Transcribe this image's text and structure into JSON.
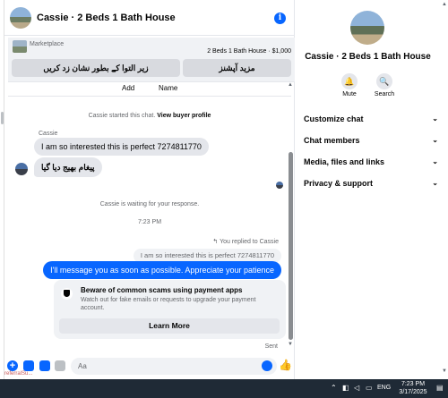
{
  "chat": {
    "title": "Cassie · 2 Beds 1 Bath House",
    "marketplace_label": "Marketplace",
    "listing": "2 Beds 1 Bath House · $1,000",
    "btn_mark_pending": "زیر التوا کے بطور نشان زد کریں",
    "btn_more_options": "مزید آپشنز",
    "cut_add": "Add",
    "cut_name": "Name",
    "started_text": "Cassie started this chat.",
    "view_profile": "View buyer profile",
    "sender_name": "Cassie",
    "msg_in_1": "I am so interested this is perfect 7274811770",
    "msg_in_2": "پیغام بھیج دیا گیا",
    "waiting_text": "Cassie is waiting for your response.",
    "time": "7:23 PM",
    "replied_label": "You replied to Cassie",
    "quoted": "I am so interested this is perfect 7274811770",
    "msg_out": "I'll message you as soon as possible. Appreciate your patience",
    "scam_title": "Beware of common scams using payment apps",
    "scam_body": "Watch out for fake emails or requests to upgrade your payment account.",
    "learn_more": "Learn More",
    "sent_status": "Sent",
    "composer_placeholder": "Aa",
    "referral": "referralSu..."
  },
  "side": {
    "name": "Cassie · 2 Beds 1 Bath House",
    "mute_label": "Mute",
    "search_label": "Search",
    "sections": [
      "Customize chat",
      "Chat members",
      "Media, files and links",
      "Privacy & support"
    ]
  },
  "taskbar": {
    "lang": "ENG",
    "time": "7:23 PM",
    "date": "3/17/2025"
  },
  "colors": {
    "accent": "#0866ff",
    "bubble_in": "#e4e6eb",
    "taskbar": "#1f2a36"
  },
  "icons": [
    "info-icon",
    "bell-icon",
    "search-icon",
    "chevron-down-icon",
    "plus-icon",
    "image-icon",
    "sticker-icon",
    "gif-icon",
    "emoji-icon",
    "thumbs-up-icon",
    "shield-icon"
  ]
}
